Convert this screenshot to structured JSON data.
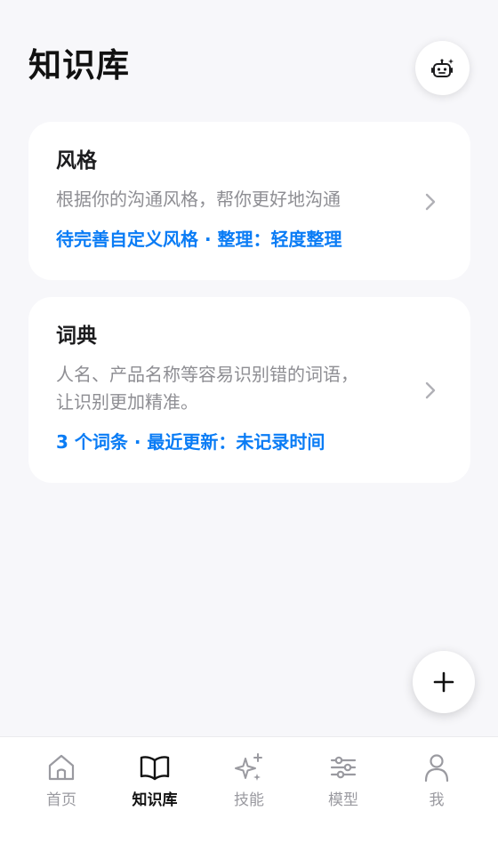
{
  "header": {
    "title": "知识库",
    "assistant_icon": "robot-sparkle-icon"
  },
  "cards": {
    "style": {
      "title": "风格",
      "description": "根据你的沟通风格，帮你更好地沟通",
      "meta": "待完善自定义风格 · 整理：轻度整理"
    },
    "dictionary": {
      "title": "词典",
      "description_line1": "人名、产品名称等容易识别错的词语，",
      "description_line2": "让识别更加精准。",
      "meta": "3 个词条 · 最近更新：未记录时间"
    }
  },
  "fab": {
    "icon": "plus-icon"
  },
  "tabbar": {
    "active": "knowledge",
    "items": [
      {
        "id": "home",
        "label": "首页",
        "icon": "home-icon"
      },
      {
        "id": "knowledge",
        "label": "知识库",
        "icon": "book-icon"
      },
      {
        "id": "skills",
        "label": "技能",
        "icon": "sparkles-icon"
      },
      {
        "id": "model",
        "label": "模型",
        "icon": "sliders-icon"
      },
      {
        "id": "me",
        "label": "我",
        "icon": "person-icon"
      }
    ]
  },
  "colors": {
    "background": "#f7f7fa",
    "accent": "#0a7cf5",
    "muted": "#8e8e93",
    "inactive_tab": "#9a9aa0"
  }
}
